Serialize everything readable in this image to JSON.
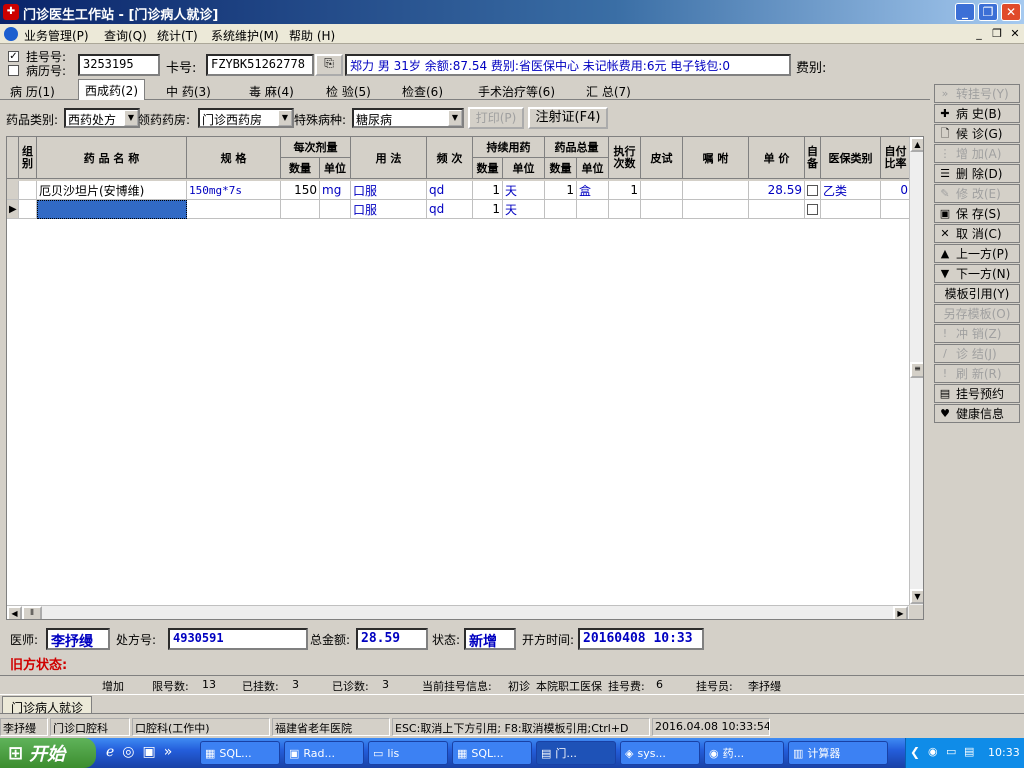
{
  "window": {
    "title": "门诊医生工作站 - [门诊病人就诊]"
  },
  "menu": [
    "业务管理(P)",
    "查询(Q)",
    "统计(T)",
    "系统维护(M)",
    "帮助 (H)"
  ],
  "toolbar": {
    "reg_no_label": "挂号号:",
    "record_no_label": "病历号:",
    "record_no_value": "3253195",
    "card_label": "卡号:",
    "card_value": "FZYBK51262778",
    "patient_info": "郑力 男 31岁 余额:87.54 费别:省医保中心 未记帐费用:6元 电子钱包:0",
    "fee_label": "费别:"
  },
  "tabs": [
    "病 历(1)",
    "西成药(2)",
    "中 药(3)",
    "毒 麻(4)",
    "检 验(5)",
    "检查(6)",
    "手术治疗等(6)",
    "汇 总(7)"
  ],
  "filter": {
    "drug_type_label": "药品类别:",
    "drug_type_value": "西药处方",
    "pharmacy_label": "领药药房:",
    "pharmacy_value": "门诊西药房",
    "disease_label": "特殊病种:",
    "disease_value": "糖尿病",
    "print_label": "打印(P)",
    "injection_label": "注射证(F4)"
  },
  "grid": {
    "headers": {
      "group": "组别",
      "name": "药 品 名 称",
      "spec": "规 格",
      "dose": "每次剂量",
      "qty": "数量",
      "unit": "单位",
      "usage": "用 法",
      "freq": "频 次",
      "duration": "持续用药",
      "total": "药品总量",
      "exec": "执行次数",
      "skin": "皮试",
      "advice": "嘱 咐",
      "price": "单 价",
      "self": "自备",
      "ins_type": "医保类别",
      "ratio": "自付比率"
    },
    "rows": [
      {
        "name": "厄贝沙坦片(安博维)",
        "spec": "150mg*7s",
        "dose_qty": "150",
        "dose_unit": "mg",
        "usage": "口服",
        "freq": "qd",
        "dur_qty": "1",
        "dur_unit": "天",
        "total_qty": "1",
        "total_unit": "盒",
        "exec": "1",
        "price": "28.59",
        "ins_type": "乙类",
        "ratio": "0"
      },
      {
        "name": "",
        "spec": "",
        "dose_qty": "",
        "dose_unit": "",
        "usage": "口服",
        "freq": "qd",
        "dur_qty": "1",
        "dur_unit": "天",
        "total_qty": "",
        "total_unit": "",
        "exec": "",
        "price": "",
        "ins_type": "",
        "ratio": ""
      }
    ]
  },
  "right_buttons": [
    {
      "label": "转挂号(Y)",
      "icon": "double-chevron-icon",
      "disabled": true
    },
    {
      "label": "病 史(B)",
      "icon": "plus-icon",
      "disabled": false
    },
    {
      "label": "候 诊(G)",
      "icon": "page-icon",
      "disabled": false
    },
    {
      "label": "增 加(A)",
      "icon": "add-icon",
      "disabled": true
    },
    {
      "label": "删 除(D)",
      "icon": "delete-icon",
      "disabled": false
    },
    {
      "label": "修 改(E)",
      "icon": "edit-icon",
      "disabled": true
    },
    {
      "label": "保 存(S)",
      "icon": "save-icon",
      "disabled": false
    },
    {
      "label": "取 消(C)",
      "icon": "cancel-icon",
      "disabled": false
    },
    {
      "label": "上一方(P)",
      "icon": "up-arrow-icon",
      "disabled": false
    },
    {
      "label": "下一方(N)",
      "icon": "down-arrow-icon",
      "disabled": false
    },
    {
      "label": "模板引用(Y)",
      "icon": "",
      "disabled": false
    },
    {
      "label": "另存模板(O)",
      "icon": "",
      "disabled": true
    },
    {
      "label": "冲 销(Z)",
      "icon": "reverse-icon",
      "disabled": true
    },
    {
      "label": "诊 结(J)",
      "icon": "finish-icon",
      "disabled": true
    },
    {
      "label": "刷 新(R)",
      "icon": "refresh-icon",
      "disabled": true
    },
    {
      "label": "挂号预约",
      "icon": "booking-icon",
      "disabled": false
    },
    {
      "label": "健康信息",
      "icon": "health-icon",
      "disabled": false
    }
  ],
  "footer": {
    "doctor_label": "医师:",
    "doctor_value": "李抒缦",
    "rx_label": "处方号:",
    "rx_value": "4930591",
    "amount_label": "总金额:",
    "amount_value": "28.59",
    "state_label": "状态:",
    "state_value": "新增",
    "time_label": "开方时间:",
    "time_value": "20160408 10:33",
    "old_status": "旧方状态:"
  },
  "info_bar": [
    "增加",
    "限号数:",
    "13",
    "已挂数:",
    "3",
    "已诊数:",
    "3",
    "当前挂号信息:",
    "初诊",
    "本院职工医保",
    "挂号费:",
    "6",
    "挂号员:",
    "李抒缦"
  ],
  "doc_tab": "门诊病人就诊",
  "status_bar": [
    "李抒缦",
    "门诊口腔科",
    "口腔科(工作中)",
    "福建省老年医院",
    "ESC:取消上下方引用; F8:取消模板引用;Ctrl+D",
    "2016.04.08 10:33:54"
  ],
  "taskbar": {
    "start": "开始",
    "tasks": [
      "SQL...",
      "Rad...",
      "lis",
      "SQL...",
      "门...",
      "sys...",
      "药...",
      "计算器"
    ],
    "clock": "10:33"
  },
  "colors": {
    "title_bar": "#0a246a",
    "info_text": "#0000c0",
    "status_red": "#d00000",
    "selection": "#316ac5"
  }
}
